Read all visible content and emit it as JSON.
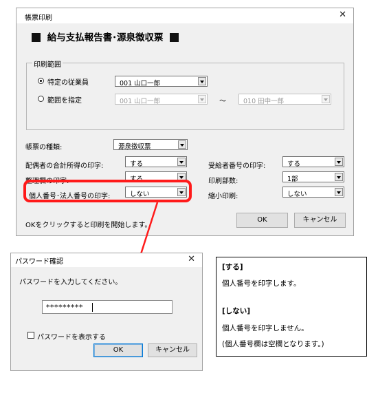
{
  "main_dialog": {
    "title": "帳票印刷",
    "heading": "給与支払報告書･源泉徴収票",
    "print_range": {
      "group_label": "印刷範囲",
      "specific_label": "特定の従業員",
      "specific_selected": true,
      "specific_value": "001 山口一郎",
      "range_label": "範囲を指定",
      "range_from": "001 山口一郎",
      "range_sep": "～",
      "range_to": "010 田中一郎"
    },
    "form_type": {
      "label": "帳票の種類:",
      "value": "源泉徴収票"
    },
    "spouse_total": {
      "label": "配偶者の合計所得の印字:",
      "value": "する"
    },
    "recipient_number": {
      "label": "受給者番号の印字:",
      "value": "する"
    },
    "reference_column": {
      "label": "整理欄の印字:",
      "value": "する"
    },
    "copies": {
      "label": "印刷部数:",
      "value": "1部"
    },
    "personal_number": {
      "label": "個人番号･法人番号の印字:",
      "value": "しない"
    },
    "reduced_print": {
      "label": "縮小印刷:",
      "value": "しない"
    },
    "footer_text": "OKをクリックすると印刷を開始します。",
    "ok_label": "OK",
    "cancel_label": "キャンセル"
  },
  "password_dialog": {
    "title": "パスワード確認",
    "prompt": "パスワードを入力してください。",
    "password_value": "*********",
    "show_password_label": "パスワードを表示する",
    "show_password_checked": false,
    "ok_label": "OK",
    "cancel_label": "キャンセル"
  },
  "note_box": {
    "heading_on": "[する]",
    "text_on": "個人番号を印字します。",
    "heading_off": "[しない]",
    "text_off": "個人番号を印字しません。",
    "text_off_sub": "(個人番号欄は空欄となります。)"
  },
  "icons": {
    "close": "close-icon",
    "dropdown": "chevron-down-icon",
    "annotation_arrow": "arrow-icon"
  },
  "colors": {
    "highlight": "#ff1a1a",
    "default_button_border": "#0078d7"
  }
}
